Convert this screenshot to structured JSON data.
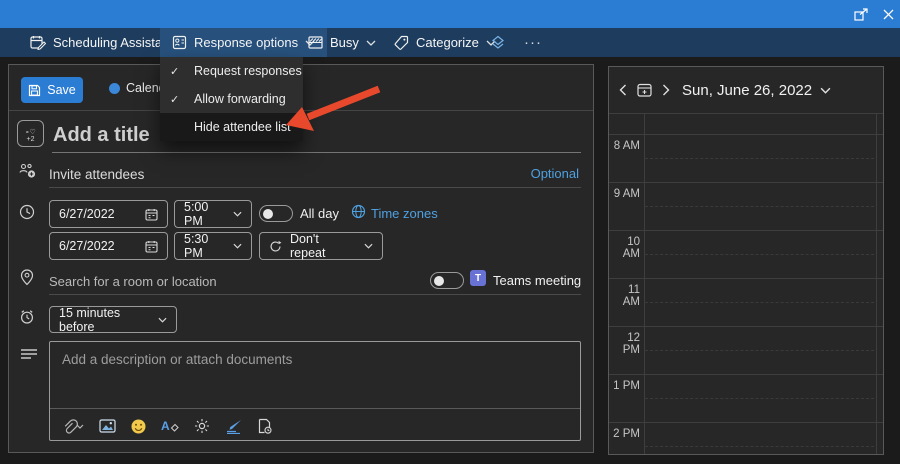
{
  "colors": {
    "titlebar_blue": "#2b7cd3",
    "toolbar_navy": "#1e3d5e",
    "accent_blue": "#2b7cd3",
    "link_blue": "#4fa0e0",
    "arrow_red": "#e8492c",
    "teams_purple": "#6872d5",
    "emoji_yellow": "#f2c94c"
  },
  "toolbar": {
    "scheduling_assistant_label": "Scheduling Assistant",
    "response_options_label": "Response options",
    "busy_label": "Busy",
    "categorize_label": "Categorize",
    "more_label": "···"
  },
  "menu": {
    "check_glyph": "✓",
    "items": [
      {
        "label": "Request responses",
        "checked": true
      },
      {
        "label": "Allow forwarding",
        "checked": true
      },
      {
        "label": "Hide attendee list",
        "checked": false
      }
    ]
  },
  "form": {
    "save_label": "Save",
    "calendar_name": "Calendar",
    "charm_top": "∘♡",
    "charm_bottom": "+2",
    "title_placeholder": "Add a title",
    "attendees_placeholder": "Invite attendees",
    "optional_label": "Optional",
    "start_date": "6/27/2022",
    "start_time": "5:00 PM",
    "all_day_label": "All day",
    "time_zones_label": "Time zones",
    "end_date": "6/27/2022",
    "end_time": "5:30 PM",
    "repeat_label": "Don't repeat",
    "location_placeholder": "Search for a room or location",
    "teams_logo_letter": "T",
    "teams_meeting_label": "Teams meeting",
    "reminder_value": "15 minutes before",
    "description_placeholder": "Add a description or attach documents"
  },
  "calendar_panel": {
    "date_label": "Sun, June 26, 2022",
    "hours": [
      "8 AM",
      "9 AM",
      "10 AM",
      "11 AM",
      "12 PM",
      "1 PM",
      "2 PM"
    ]
  }
}
